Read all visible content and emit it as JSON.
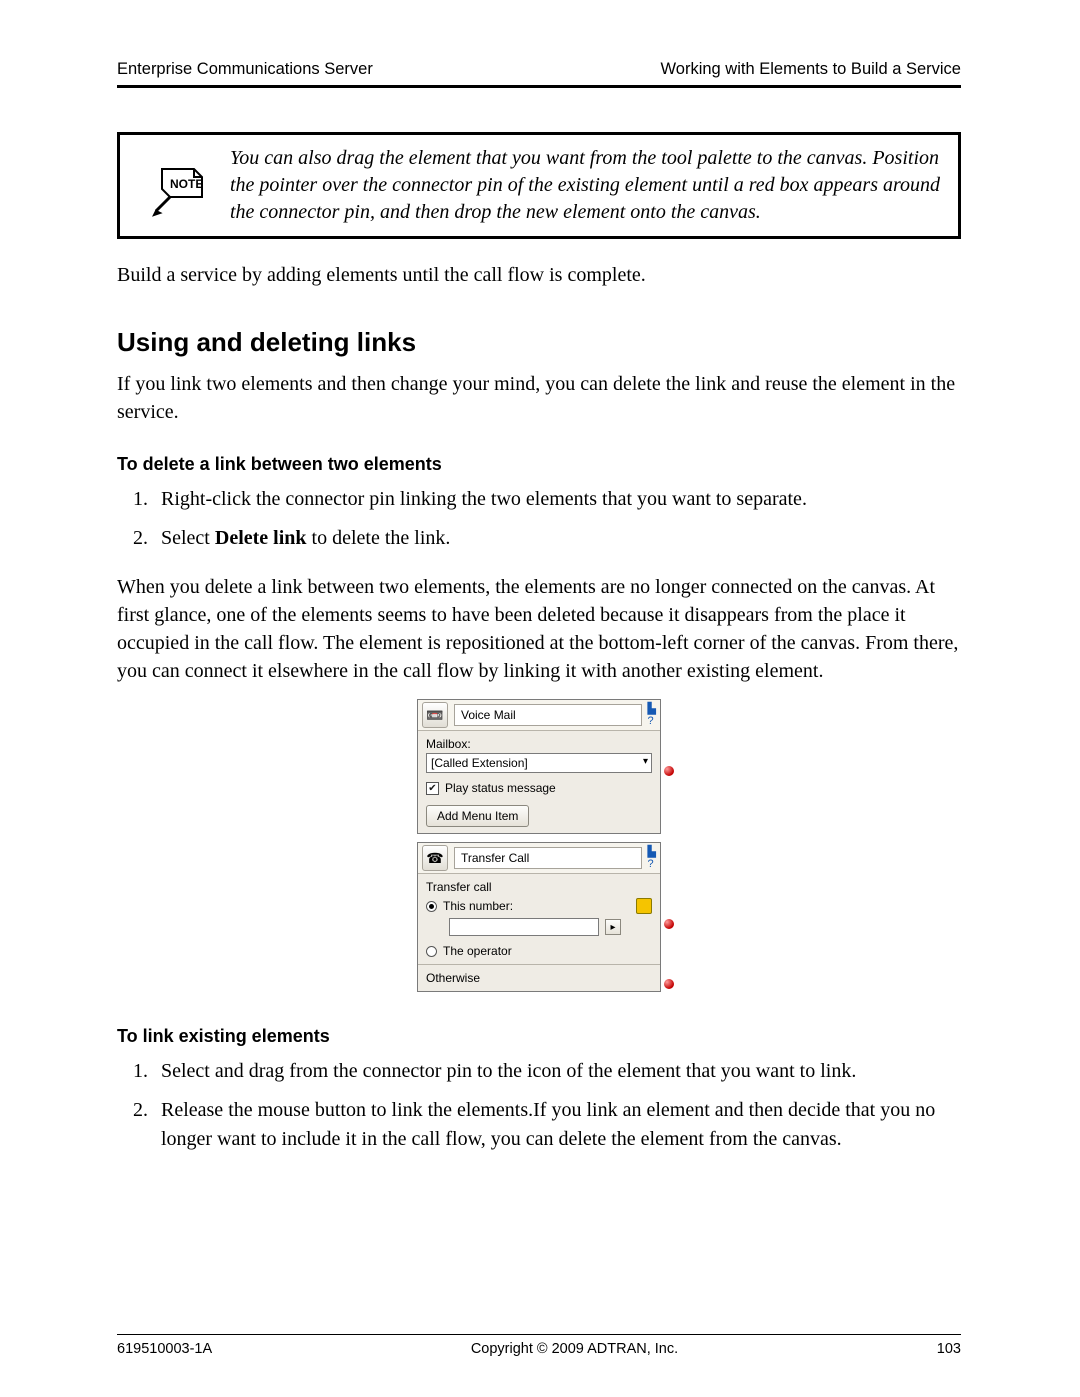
{
  "header": {
    "left": "Enterprise Communications Server",
    "right": "Working with Elements to Build a Service"
  },
  "note": {
    "label": "NOTE",
    "text": "You can also drag the element that you want from the tool palette to the canvas. Position the pointer over the connector pin of the existing element until a red box appears around the connector pin, and then drop the new element onto the canvas."
  },
  "para_intro": "Build a service by adding elements until the call flow is complete.",
  "h2": "Using and deleting links",
  "para_h2": "If you link two elements and then change your mind, you can delete the link and reuse the element in the service.",
  "h3_delete": "To delete a link between two elements",
  "steps_delete": [
    {
      "text": "Right-click the connector pin linking the two elements that you want to separate."
    },
    {
      "pre": "Select ",
      "bold": "Delete link",
      "post": " to delete the link."
    }
  ],
  "para_after_delete": "When you delete a link between two elements, the elements are no longer connected on the canvas. At first glance, one of the elements seems to have been deleted because it disappears from the place it occupied in the call flow. The element is repositioned at the bottom-left corner of the canvas. From there, you can connect it elsewhere in the call flow by linking it with another existing element.",
  "ui": {
    "voicemail": {
      "title": "Voice Mail",
      "mailbox_label": "Mailbox:",
      "mailbox_value": "[Called Extension]",
      "play_status": "Play status message",
      "add_menu": "Add Menu Item"
    },
    "transfer": {
      "title": "Transfer Call",
      "section": "Transfer call",
      "this_number": "This number:",
      "the_operator": "The operator",
      "otherwise": "Otherwise"
    }
  },
  "h3_link": "To link existing elements",
  "steps_link": [
    {
      "text": "Select and drag from the connector pin to the icon of the element that you want to link."
    },
    {
      "text": "Release the mouse button to link the elements.If you link an element and then decide that you no longer want to include it in the call flow, you can delete the element from the canvas."
    }
  ],
  "footer": {
    "left": "619510003-1A",
    "center": "Copyright © 2009 ADTRAN, Inc.",
    "right": "103"
  }
}
